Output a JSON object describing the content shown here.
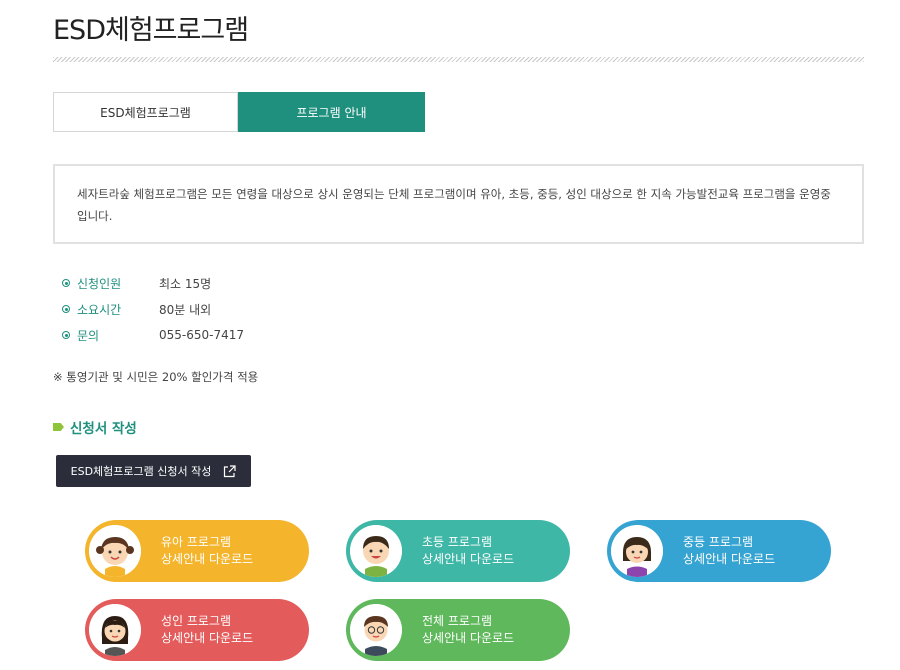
{
  "page": {
    "title": "ESD체험프로그램"
  },
  "tabs": [
    {
      "label": "ESD체험프로그램",
      "active": false
    },
    {
      "label": "프로그램 안내",
      "active": true
    }
  ],
  "description": "세자트라숲 체험프로그램은 모든 연령을 대상으로 상시 운영되는 단체 프로그램이며 유아, 초등, 중등, 성인 대상으로 한 지속 가능발전교육 프로그램을 운영중입니다.",
  "info": [
    {
      "label": "신청인원",
      "value": "최소 15명"
    },
    {
      "label": "소요시간",
      "value": "80분 내외"
    },
    {
      "label": "문의",
      "value": "055-650-7417"
    }
  ],
  "note": "※ 통영기관 및 시민은 20% 할인가격 적용",
  "section": {
    "title": "신청서 작성"
  },
  "apply_button": {
    "label": "ESD체험프로그램 신청서 작성"
  },
  "downloads": [
    {
      "line1": "유아 프로그램",
      "line2": "상세안내 다운로드",
      "color": "#f4b52c"
    },
    {
      "line1": "초등 프로그램",
      "line2": "상세안내 다운로드",
      "color": "#3eb7a7"
    },
    {
      "line1": "중등 프로그램",
      "line2": "상세안내 다운로드",
      "color": "#36a4d2"
    },
    {
      "line1": "성인 프로그램",
      "line2": "상세안내 다운로드",
      "color": "#e35b5b"
    },
    {
      "line1": "전체 프로그램",
      "line2": "상세안내 다운로드",
      "color": "#5fb85c"
    }
  ],
  "colors": {
    "accent": "#1f8f7e",
    "button_dark": "#2b2e3a",
    "tag_green": "#8dc43a"
  }
}
